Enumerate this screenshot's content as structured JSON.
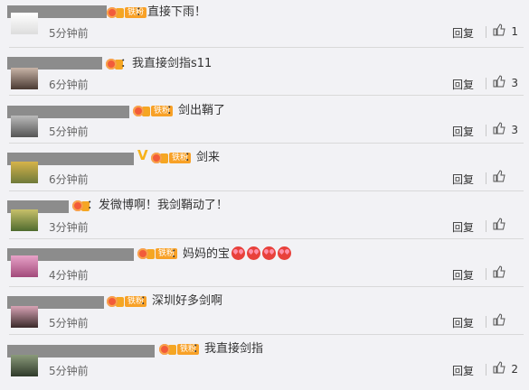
{
  "labels": {
    "reply": "回复",
    "fans": "铁粉",
    "sep": "："
  },
  "icons": {
    "like": "thumbs-up-icon",
    "level": "fan-heart-icon",
    "verified": "v-badge-icon"
  },
  "colors": {
    "fans_badge": "#f8a127",
    "heart": "#f25b3a",
    "name_redaction": "#8c8c8c"
  },
  "comments": [
    {
      "text": "直接下雨！",
      "time": "5分钟前",
      "likes": "1",
      "fans_badge": true
    },
    {
      "text": "我直接剑指s11",
      "time": "6分钟前",
      "likes": "3",
      "fans_badge": false
    },
    {
      "text": "剑出鞘了",
      "time": "5分钟前",
      "likes": "3",
      "fans_badge": true
    },
    {
      "text": "剑来",
      "time": "6分钟前",
      "likes": "",
      "fans_badge": true,
      "verified": "V"
    },
    {
      "text": "发微博啊！我剑鞘动了！",
      "time": "3分钟前",
      "likes": "",
      "fans_badge": false
    },
    {
      "text": "妈妈的宝",
      "time": "4分钟前",
      "likes": "",
      "fans_badge": true,
      "emoji_count": 4
    },
    {
      "text": "深圳好多剑啊",
      "time": "5分钟前",
      "likes": "",
      "fans_badge": true
    },
    {
      "text": "我直接剑指",
      "time": "5分钟前",
      "likes": "2",
      "fans_badge": true
    }
  ]
}
